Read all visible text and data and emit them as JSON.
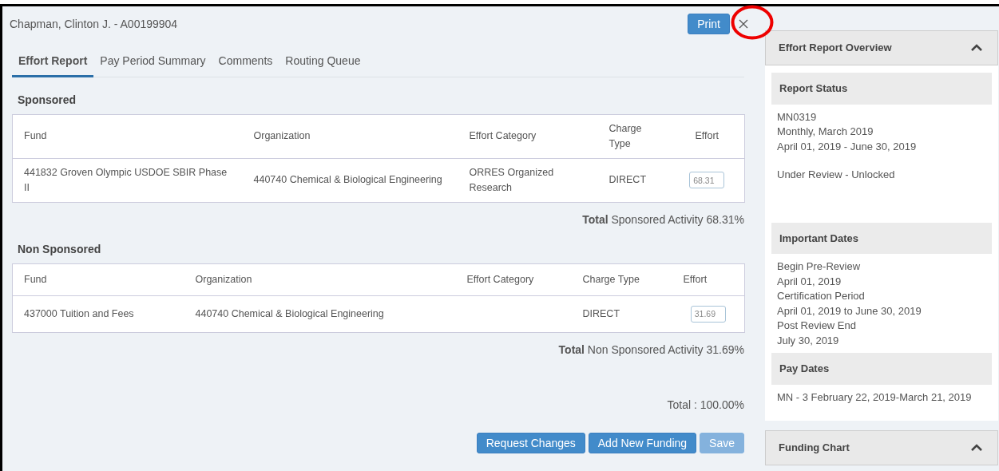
{
  "header": {
    "title": "Chapman, Clinton J. - A00199904",
    "print_button": "Print"
  },
  "tabs": [
    {
      "label": "Effort Report",
      "selected": true
    },
    {
      "label": "Pay Period Summary",
      "selected": false
    },
    {
      "label": "Comments",
      "selected": false
    },
    {
      "label": "Routing Queue",
      "selected": false
    }
  ],
  "sections": [
    {
      "title": "Sponsored",
      "columns": [
        "Fund",
        "Organization",
        "Effort Category",
        "Charge Type",
        "Effort"
      ],
      "rows": [
        {
          "cells": [
            "441832 Groven Olympic USDOE SBIR Phase II",
            "440740 Chemical & Biological Engineering",
            "ORRES Organized Research",
            "DIRECT"
          ],
          "effort": "68.31"
        }
      ],
      "total": "**Total** Sponsored Activity 68.31%"
    },
    {
      "title": "Non Sponsored",
      "columns": [
        "Fund",
        "Organization",
        "Effort Category",
        "Charge Type",
        "Effort"
      ],
      "rows": [
        {
          "cells": [
            "437000 Tuition and Fees",
            "440740 Chemical & Biological Engineering",
            "",
            "DIRECT"
          ],
          "effort": "31.69"
        }
      ],
      "total": "**Total** Non Sponsored Activity 31.69%"
    }
  ],
  "grand_total": "Total : 100.00%",
  "buttons": [
    {
      "label": "Request Changes",
      "disabled": false
    },
    {
      "label": "Add New Funding",
      "disabled": false
    },
    {
      "label": "Save",
      "disabled": true
    }
  ],
  "panels": [
    {
      "title": "Effort Report Overview",
      "expanded": true,
      "sections": [
        {
          "heading": "Report Status",
          "lines": [
            "MN0319",
            "Monthly, March 2019",
            "April 01, 2019 - June 30, 2019"
          ],
          "note": "Under Review - Unlocked"
        },
        {
          "heading": "Important Dates",
          "lines": [
            "Begin Pre-Review",
            "April 01, 2019",
            "Certification Period",
            "April 01, 2019 to June 30, 2019",
            "Post Review End",
            "July 30, 2019"
          ]
        },
        {
          "heading": "Pay Dates",
          "lines": [
            "MN - 3 February 22, 2019-March 21, 2019"
          ]
        }
      ]
    },
    {
      "title": "Funding Chart",
      "expanded": true
    }
  ]
}
